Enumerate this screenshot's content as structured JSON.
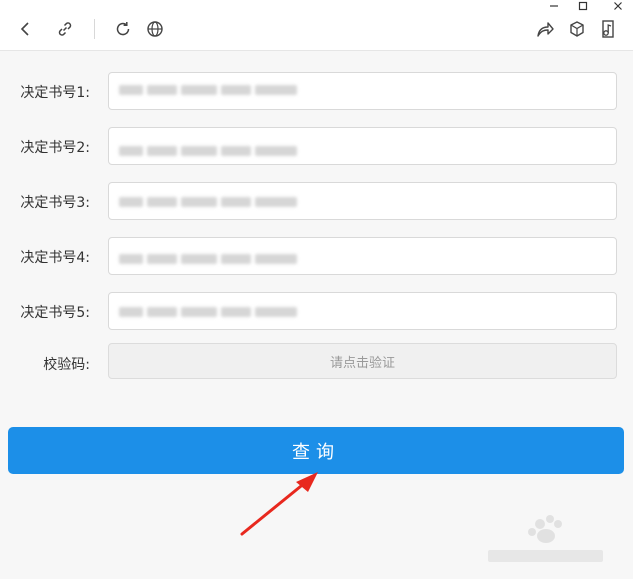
{
  "window": {
    "controls": [
      "minimize-icon",
      "maximize-icon",
      "close-icon"
    ]
  },
  "toolbar": {
    "icons": [
      "back-icon",
      "link-icon",
      "refresh-icon",
      "globe-icon",
      "share-icon",
      "cube-icon",
      "music-note-icon"
    ]
  },
  "form": {
    "rows": [
      {
        "label": "决定书号1:",
        "value": ""
      },
      {
        "label": "决定书号2:",
        "value": ""
      },
      {
        "label": "决定书号3:",
        "value": ""
      },
      {
        "label": "决定书号4:",
        "value": ""
      },
      {
        "label": "决定书号5:",
        "value": ""
      }
    ],
    "captcha": {
      "label": "校验码:",
      "button_text": "请点击验证"
    },
    "submit_label": "查询"
  },
  "colors": {
    "accent": "#1c8fe8",
    "arrow": "#e8281e",
    "background": "#f7f7f7"
  }
}
